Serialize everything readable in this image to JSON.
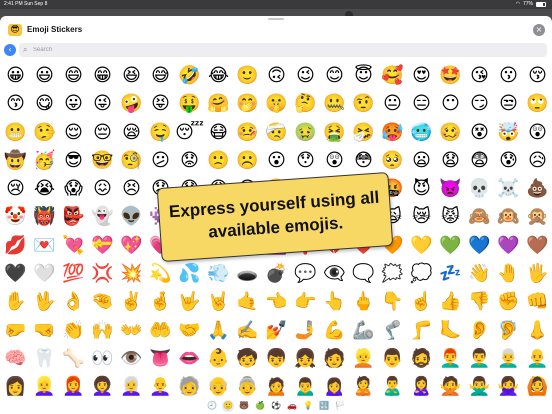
{
  "status": {
    "time": "2:41 PM",
    "date": "Sun Sep 8",
    "battery": "77%",
    "battery_fraction": 0.77
  },
  "header": {
    "title": "Emoji Stickers",
    "app_icon": "😎"
  },
  "search": {
    "placeholder": "Search",
    "value": ""
  },
  "promo": {
    "text": "Express yourself using all available emojis."
  },
  "emojis": [
    "😀",
    "😃",
    "😄",
    "😁",
    "😆",
    "😅",
    "🤣",
    "😂",
    "🙂",
    "🙃",
    "😉",
    "😊",
    "😇",
    "🥰",
    "😍",
    "🤩",
    "😘",
    "😗",
    "😚",
    "😙",
    "😋",
    "😛",
    "😜",
    "🤪",
    "😝",
    "🤑",
    "🤗",
    "🤭",
    "🤫",
    "🤔",
    "🤐",
    "🤨",
    "😐",
    "😑",
    "😶",
    "😏",
    "😒",
    "🙄",
    "😬",
    "🤥",
    "😌",
    "😔",
    "😪",
    "🤤",
    "😴",
    "😷",
    "🤒",
    "🤕",
    "🤢",
    "🤮",
    "🤧",
    "🥵",
    "🥶",
    "🥴",
    "😵",
    "🤯",
    "😲",
    "🤠",
    "🥳",
    "😎",
    "🤓",
    "🧐",
    "😕",
    "😟",
    "🙁",
    "☹️",
    "😮",
    "😯",
    "😲",
    "😳",
    "🥺",
    "😦",
    "😧",
    "😨",
    "😰",
    "😥",
    "😢",
    "😭",
    "😱",
    "😖",
    "😣",
    "😞",
    "😓",
    "😩",
    "😫",
    "🥱",
    "😤",
    "😡",
    "😠",
    "🤬",
    "😈",
    "👿",
    "💀",
    "☠️",
    "💩",
    "🤡",
    "👹",
    "👺",
    "👻",
    "👽",
    "👾",
    "🤖",
    "😺",
    "😸",
    "😹",
    "😻",
    "😼",
    "😽",
    "🙀",
    "😿",
    "😾",
    "🙈",
    "🙉",
    "🙊",
    "💋",
    "💌",
    "💘",
    "💝",
    "💖",
    "💗",
    "💓",
    "💞",
    "💕",
    "💟",
    "❣️",
    "💔",
    "❤️",
    "🧡",
    "💛",
    "💚",
    "💙",
    "💜",
    "🤎",
    "🖤",
    "🤍",
    "💯",
    "💢",
    "💥",
    "💫",
    "💦",
    "💨",
    "🕳️",
    "💣",
    "💬",
    "👁️‍🗨️",
    "🗨️",
    "🗯️",
    "💭",
    "💤",
    "👋",
    "🤚",
    "🖐️",
    "✋",
    "🖖",
    "👌",
    "🤏",
    "✌️",
    "🤞",
    "🤟",
    "🤘",
    "🤙",
    "👈",
    "👉",
    "👆",
    "🖕",
    "👇",
    "☝️",
    "👍",
    "👎",
    "✊",
    "👊",
    "🤛",
    "🤜",
    "👏",
    "🙌",
    "👐",
    "🤲",
    "🤝",
    "🙏",
    "✍️",
    "💅",
    "🤳",
    "💪",
    "🦾",
    "🦿",
    "🦵",
    "🦶",
    "👂",
    "🦻",
    "👃",
    "🧠",
    "🦷",
    "🦴",
    "👀",
    "👁️",
    "👅",
    "👄",
    "👶",
    "🧒",
    "👦",
    "👧",
    "🧑",
    "👱",
    "👨",
    "🧔",
    "👨‍🦰",
    "👨‍🦱",
    "👨‍🦳",
    "👨‍🦲",
    "👩",
    "👱‍♀️",
    "👩‍🦰",
    "👩‍🦱",
    "👩‍🦳",
    "👩‍🦲",
    "🧓",
    "👴",
    "👵",
    "🙍",
    "🙍‍♂️",
    "🙍‍♀️",
    "🙎",
    "🙎‍♂️",
    "🙎‍♀️",
    "🙅",
    "🙅‍♂️",
    "🙅‍♀️",
    "🙆"
  ],
  "categories": [
    {
      "icon": "🕘",
      "name": "recent"
    },
    {
      "icon": "🙂",
      "name": "smileys"
    },
    {
      "icon": "🐻",
      "name": "animals"
    },
    {
      "icon": "🍏",
      "name": "food"
    },
    {
      "icon": "⚽",
      "name": "activity"
    },
    {
      "icon": "🚗",
      "name": "travel"
    },
    {
      "icon": "💡",
      "name": "objects"
    },
    {
      "icon": "🔣",
      "name": "symbols"
    },
    {
      "icon": "🏳️",
      "name": "flags"
    }
  ],
  "selected_category": 1
}
